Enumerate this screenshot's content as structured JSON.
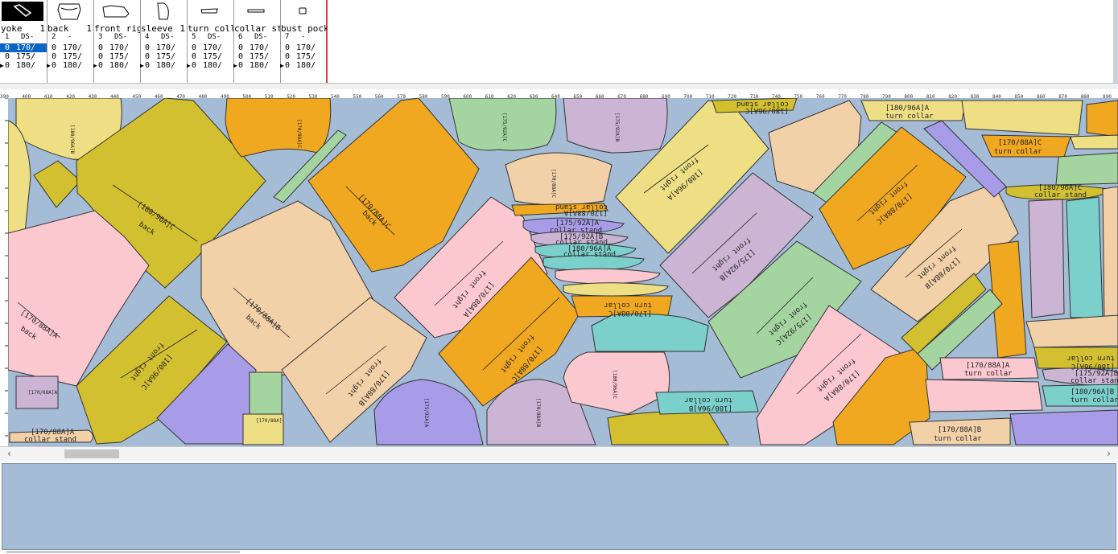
{
  "pieces": [
    {
      "name": "yoke",
      "count": "1",
      "num": "1",
      "code": "DS-",
      "thumb": "yoke-icon",
      "selected": true,
      "rows": [
        {
          "q": "0",
          "size": "170/"
        },
        {
          "q": "0",
          "size": "175/"
        },
        {
          "q": "0",
          "size": "180/"
        }
      ]
    },
    {
      "name": "back",
      "count": "1",
      "num": "2",
      "code": "-",
      "thumb": "back-icon",
      "selected": false,
      "rows": [
        {
          "q": "0",
          "size": "170/"
        },
        {
          "q": "0",
          "size": "175/"
        },
        {
          "q": "0",
          "size": "180/"
        }
      ]
    },
    {
      "name": "front rig",
      "count": "",
      "num": "3",
      "code": "DS-",
      "thumb": "front-right-icon",
      "selected": false,
      "rows": [
        {
          "q": "0",
          "size": "170/"
        },
        {
          "q": "0",
          "size": "175/"
        },
        {
          "q": "0",
          "size": "180/"
        }
      ]
    },
    {
      "name": "sleeve",
      "count": "1",
      "num": "4",
      "code": "DS-",
      "thumb": "sleeve-icon",
      "selected": false,
      "rows": [
        {
          "q": "0",
          "size": "170/"
        },
        {
          "q": "0",
          "size": "175/"
        },
        {
          "q": "0",
          "size": "180/"
        }
      ]
    },
    {
      "name": "turn coll",
      "count": "",
      "num": "5",
      "code": "DS-",
      "thumb": "turn-collar-icon",
      "selected": false,
      "rows": [
        {
          "q": "0",
          "size": "170/"
        },
        {
          "q": "0",
          "size": "175/"
        },
        {
          "q": "0",
          "size": "180/"
        }
      ]
    },
    {
      "name": "collar st",
      "count": "",
      "num": "6",
      "code": "DS-",
      "thumb": "collar-stand-icon",
      "selected": false,
      "rows": [
        {
          "q": "0",
          "size": "170/"
        },
        {
          "q": "0",
          "size": "175/"
        },
        {
          "q": "0",
          "size": "180/"
        }
      ]
    },
    {
      "name": "bust pock",
      "count": "",
      "num": "7",
      "code": "-",
      "thumb": "bust-pocket-icon",
      "selected": false,
      "rows": [
        {
          "q": "0",
          "size": "170/"
        },
        {
          "q": "0",
          "size": "175/"
        },
        {
          "q": "0",
          "size": "180/"
        }
      ]
    }
  ],
  "ruler": {
    "ticks": [
      "390",
      "400",
      "410",
      "420",
      "430",
      "440",
      "450",
      "460",
      "470",
      "480",
      "490",
      "500",
      "510",
      "520",
      "530",
      "540",
      "550",
      "560",
      "570",
      "580",
      "590",
      "600",
      "610",
      "620",
      "630",
      "640",
      "650",
      "660",
      "670",
      "680",
      "690",
      "700",
      "710",
      "720",
      "730",
      "740",
      "750",
      "760",
      "770",
      "780",
      "790",
      "800",
      "810",
      "820",
      "830",
      "840",
      "850",
      "860",
      "870",
      "880",
      "890"
    ]
  },
  "colors": {
    "canvas": "#a4bcd6",
    "yellow": "#efdf84",
    "olive": "#d2c030",
    "orange": "#f0a820",
    "peach": "#f2d0a8",
    "pink": "#fcc8d0",
    "green": "#a4d4a0",
    "lilac": "#ccb4d4",
    "purple": "#a89ce8",
    "teal": "#7cd0cc",
    "lime": "#c8d46a"
  },
  "labels": {
    "l180c_back": "[180/96A]C",
    "back": "back",
    "l170c_back": "[170/88A]C",
    "l170b_back": "[170/88A]B",
    "l170a_back": "[170/88A]A",
    "front_right": "front right",
    "l180c_fr": "[180/96A]C",
    "l170a_fr": "[170/88A]A",
    "l170c_fr": "[170/88A]C",
    "l170b_fr": "[170/88A]B",
    "l180a_fr": "[180/96A]A",
    "l175b_fr": "[175/92A]B",
    "l175c_fr": "[175/92A]C",
    "l175a_fr": "[175/92A]A",
    "turn_collar": "turn collar",
    "collar_stand": "collar stand",
    "l180a_tc": "[180/96A]A",
    "l170c_tc": "[170/88A]C",
    "l170a_tc": "[170/88A]A",
    "l180b_tc": "[180/96A]B",
    "l170b_tc": "[170/88A]B",
    "l180c_tc": "[180/96A]C",
    "l175a_cs": "[175/92A]A",
    "l175b_cs": "[175/92A]B",
    "l180a_cs": "[180/96A]A",
    "l170a_cs": "[170/88A]A",
    "l180c_cs": "[180/96A]C",
    "l175b_cs2": "[175/92A]B",
    "l170c_tc2": "[170/88A]C",
    "l180_cs2": "[180/96A]C",
    "sleeve": "sleeve",
    "l170b_sl": "[170/88A]B",
    "l175a_sl": "[175/92A]A",
    "l170c_sl": "[170/88A]C",
    "l180_sl": "[180/96A]C",
    "yoke": "yoke",
    "l170a_yk": "[170/88A]A",
    "l175c_yk": "[175/92A]C",
    "l180b_yk": "[180/96A]B",
    "l170c_yk": "[170/88A]C",
    "l175b_yk": "[175/92A]B",
    "bust_pocket": "bust pocket",
    "l170_bp": "[170/88A]"
  },
  "scroll": {
    "left_arrow": "‹",
    "right_arrow": "›"
  }
}
